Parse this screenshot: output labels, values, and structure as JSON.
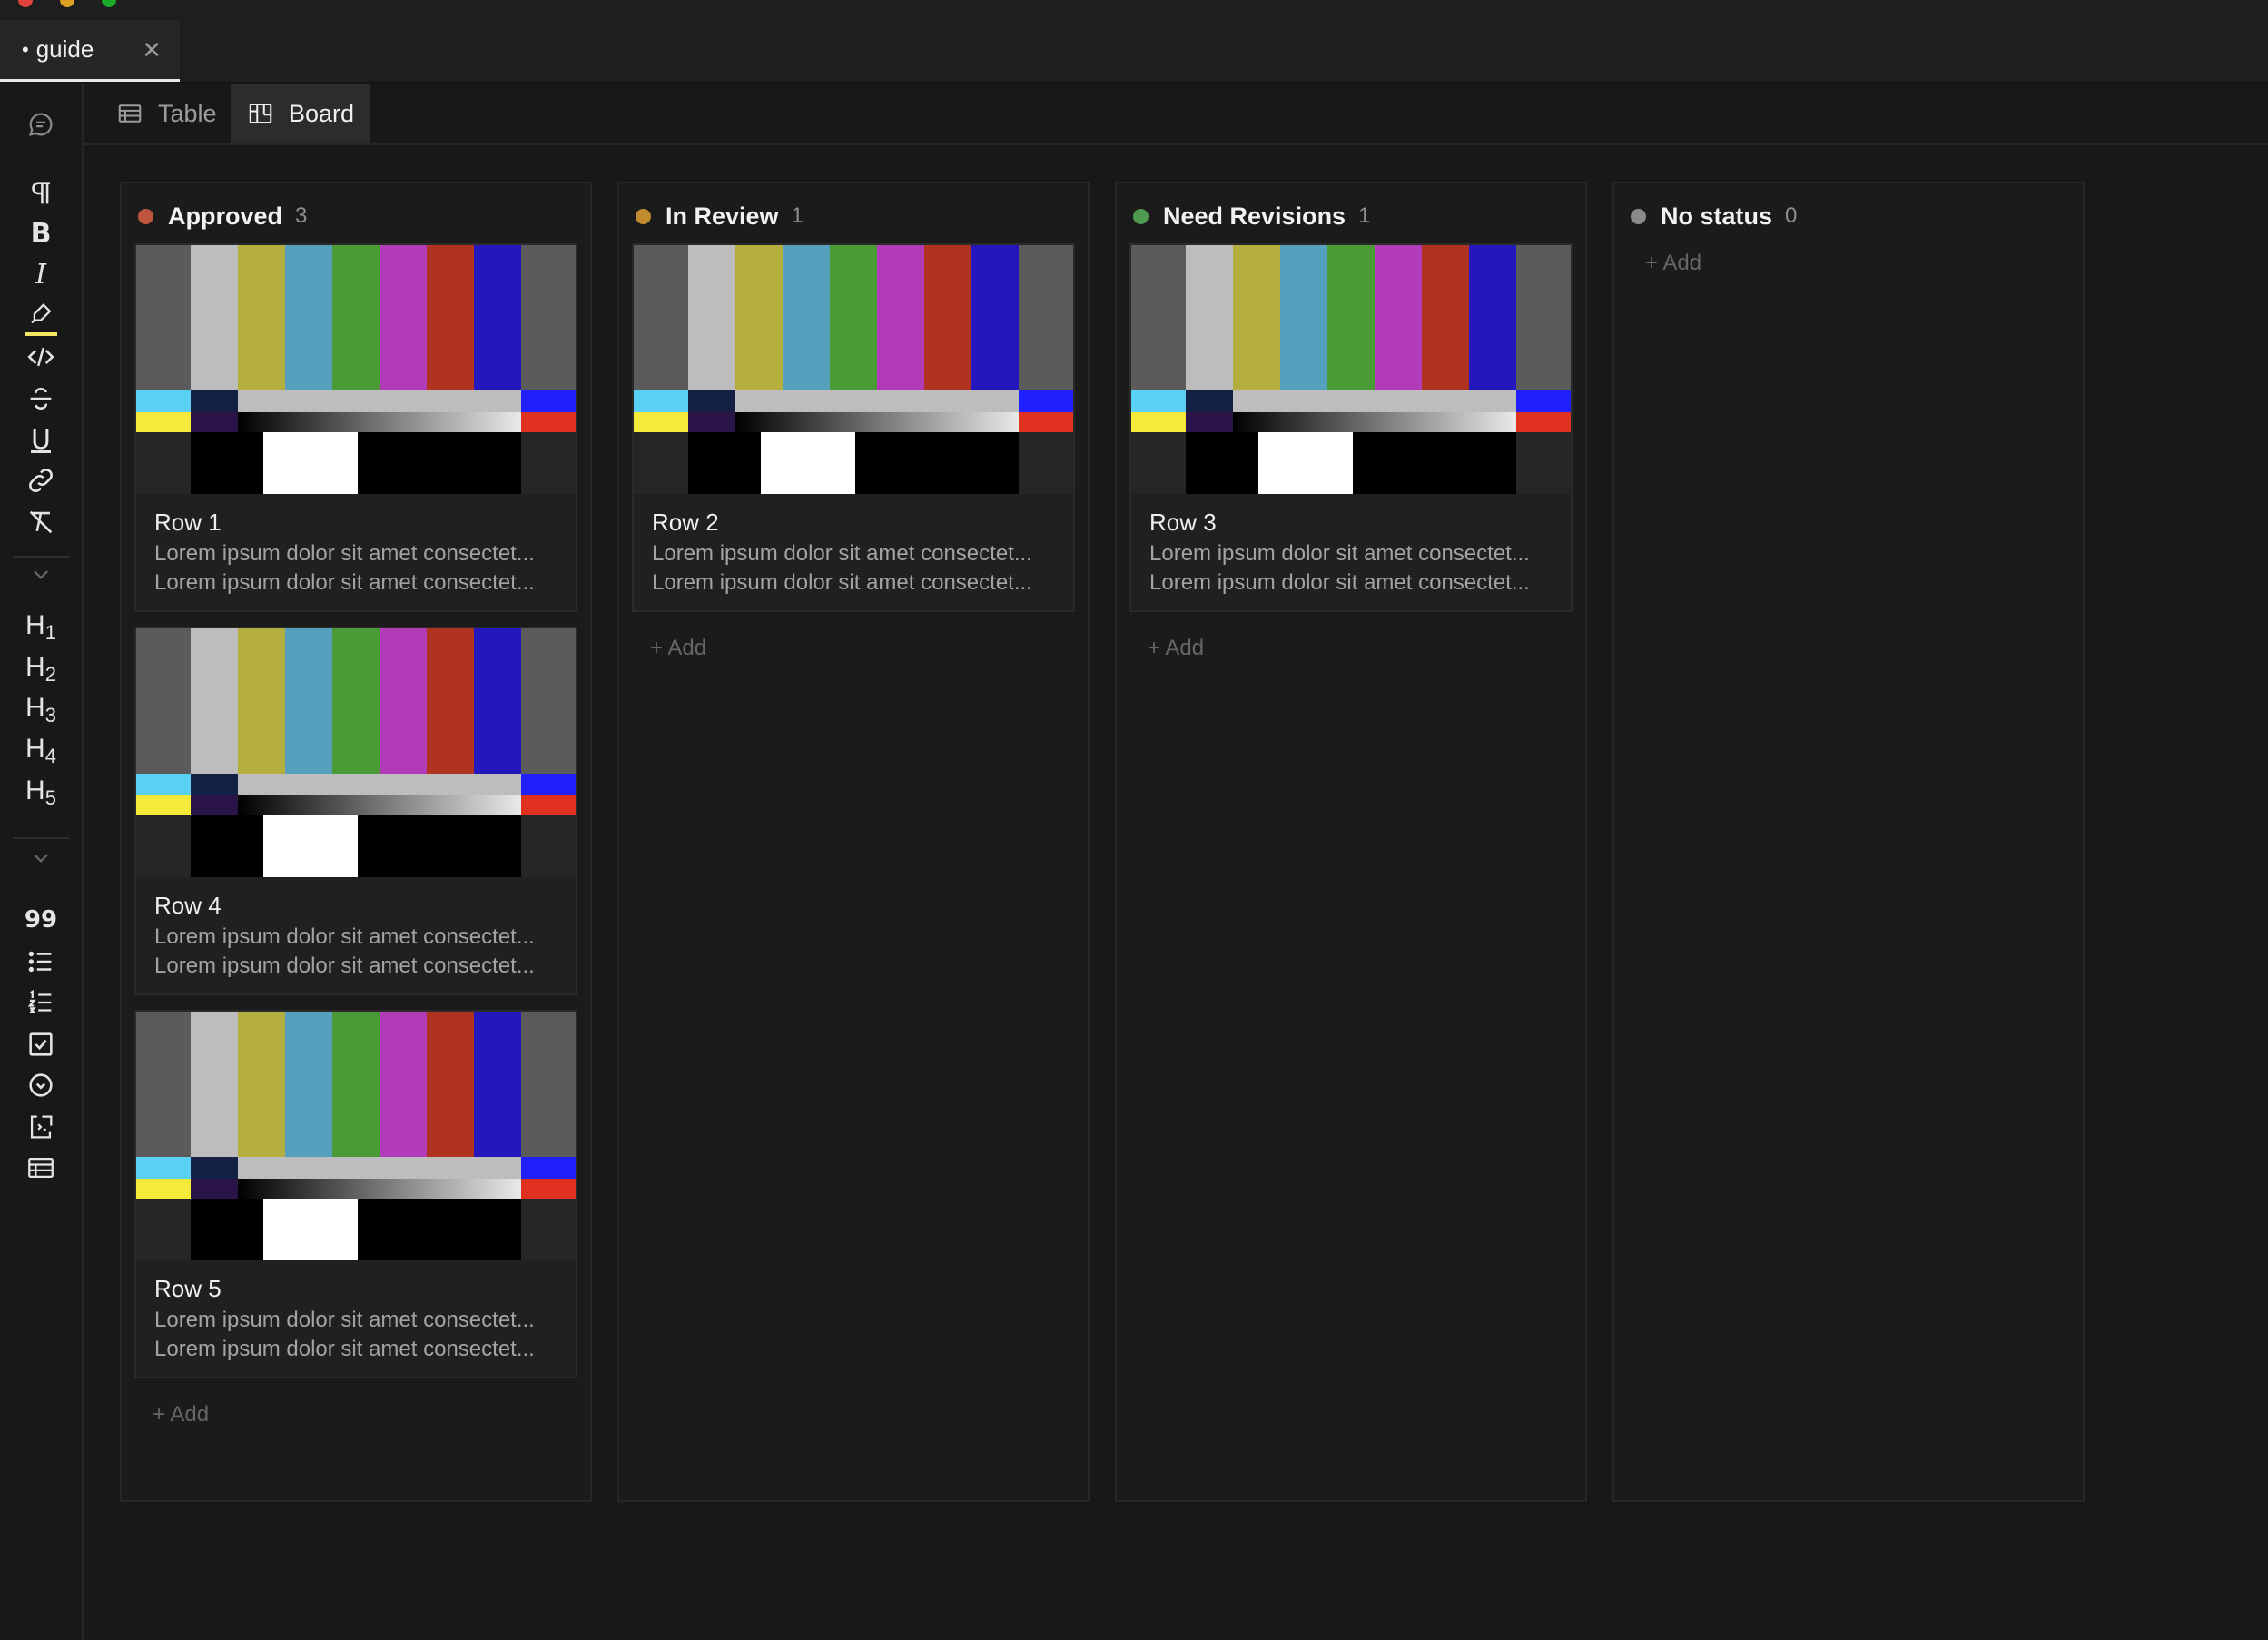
{
  "window": {
    "tab": {
      "bullet": "•",
      "title": "guide",
      "close": "✕"
    }
  },
  "toolbar": {
    "items": [
      "comment-icon",
      "paragraph-icon",
      "bold-icon",
      "italic-icon",
      "highlight-icon",
      "code-icon",
      "strikethrough-icon",
      "underline-icon",
      "link-icon",
      "clear-format-icon",
      "chevron-down-icon",
      "heading-1-icon",
      "heading-2-icon",
      "heading-3-icon",
      "heading-4-icon",
      "heading-5-icon",
      "chevron-down-icon",
      "quote-icon",
      "bullet-list-icon",
      "numbered-list-icon",
      "checklist-icon",
      "toggle-icon",
      "embed-icon",
      "table-icon"
    ],
    "bold": "B",
    "italic": "I",
    "underline": "U",
    "quote": "99",
    "h1": "H",
    "h1s": "1",
    "h2": "H",
    "h2s": "2",
    "h3": "H",
    "h3s": "3",
    "h4": "H",
    "h4s": "4",
    "h5": "H",
    "h5s": "5",
    "highlight_color": "#f5e663"
  },
  "views": {
    "table": "Table",
    "board": "Board",
    "active": "Board"
  },
  "board": {
    "add_label": "+ Add",
    "columns": [
      {
        "name": "Approved",
        "count": "3",
        "color": "#c0553d",
        "cards": [
          {
            "title": "Row 1",
            "line1": "Lorem ipsum dolor sit amet consectet...",
            "line2": "Lorem ipsum dolor sit amet consectet..."
          },
          {
            "title": "Row 4",
            "line1": "Lorem ipsum dolor sit amet consectet...",
            "line2": "Lorem ipsum dolor sit amet consectet..."
          },
          {
            "title": "Row 5",
            "line1": "Lorem ipsum dolor sit amet consectet...",
            "line2": "Lorem ipsum dolor sit amet consectet..."
          }
        ]
      },
      {
        "name": "In Review",
        "count": "1",
        "color": "#c08a2e",
        "cards": [
          {
            "title": "Row 2",
            "line1": "Lorem ipsum dolor sit amet consectet...",
            "line2": "Lorem ipsum dolor sit amet consectet..."
          }
        ]
      },
      {
        "name": "Need Revisions",
        "count": "1",
        "color": "#4e9a4e",
        "cards": [
          {
            "title": "Row 3",
            "line1": "Lorem ipsum dolor sit amet consectet...",
            "line2": "Lorem ipsum dolor sit amet consectet..."
          }
        ]
      },
      {
        "name": "No status",
        "count": "0",
        "color": "#8a8a8a",
        "cards": []
      }
    ]
  },
  "cover_palette": {
    "bars": [
      "#5b5b5b",
      "#bdbdbd",
      "#b3ae3e",
      "#55a0bc",
      "#4a9a35",
      "#b23bb8",
      "#b03220",
      "#2218bd",
      "#5b5b5b"
    ],
    "row2": [
      "#5ad0f5",
      "#152045",
      "#bdbdbd",
      "#2020ff"
    ],
    "row3": [
      "#f5ea3a",
      "#2b1548",
      "#e9e9e9",
      "#e03020"
    ],
    "bottom": [
      "#262626",
      "#000000",
      "#ffffff",
      "#000000",
      "#262626"
    ]
  }
}
